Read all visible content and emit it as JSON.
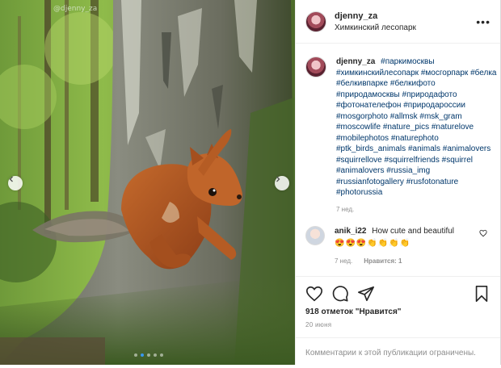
{
  "watermark": "@djenny_za",
  "post": {
    "author": "djenny_za",
    "location": "Химкинский лесопарк"
  },
  "caption": {
    "author": "djenny_za",
    "hashtags": [
      "#паркимосквы",
      "#химкинскийлесопарк",
      "#мосгорпарк",
      "#белка",
      "#белкивпарке",
      "#белкифото",
      "#природамосквы",
      "#природафото",
      "#фотонателефон",
      "#природароссии",
      "#mosgorphoto",
      "#allmsk",
      "#msk_gram",
      "#moscowlife",
      "#nature_pics",
      "#naturelove",
      "#mobilephotos",
      "#naturephoto",
      "#ptk_birds_animals",
      "#animals",
      "#animalovers",
      "#squirrellove",
      "#squirrelfriends",
      "#squirrel",
      "#animalovers",
      "#russia_img",
      "#russianfotogallery",
      "#rusfotonature",
      "#photorussia"
    ],
    "time": "7 нед."
  },
  "comment": {
    "author": "anik_i22",
    "text": "How cute and beautiful",
    "emojis": "😍😍😍👏👏👏👏",
    "time": "7 нед.",
    "like_action": "Нравится: 1"
  },
  "footer": {
    "likes": "918 отметок \"Нравится\"",
    "date": "20 июня",
    "comments_disabled": "Комментарии к этой публикации ограничены."
  },
  "carousel": {
    "slides": 5,
    "active_index": 1
  },
  "colors": {
    "link": "#00376b",
    "muted": "#8e8e8e",
    "dot_active": "#3897f0"
  },
  "icons": [
    "more-options-icon",
    "heart-icon",
    "comment-icon",
    "share-icon",
    "bookmark-icon",
    "chevron-left-icon",
    "chevron-right-icon"
  ]
}
